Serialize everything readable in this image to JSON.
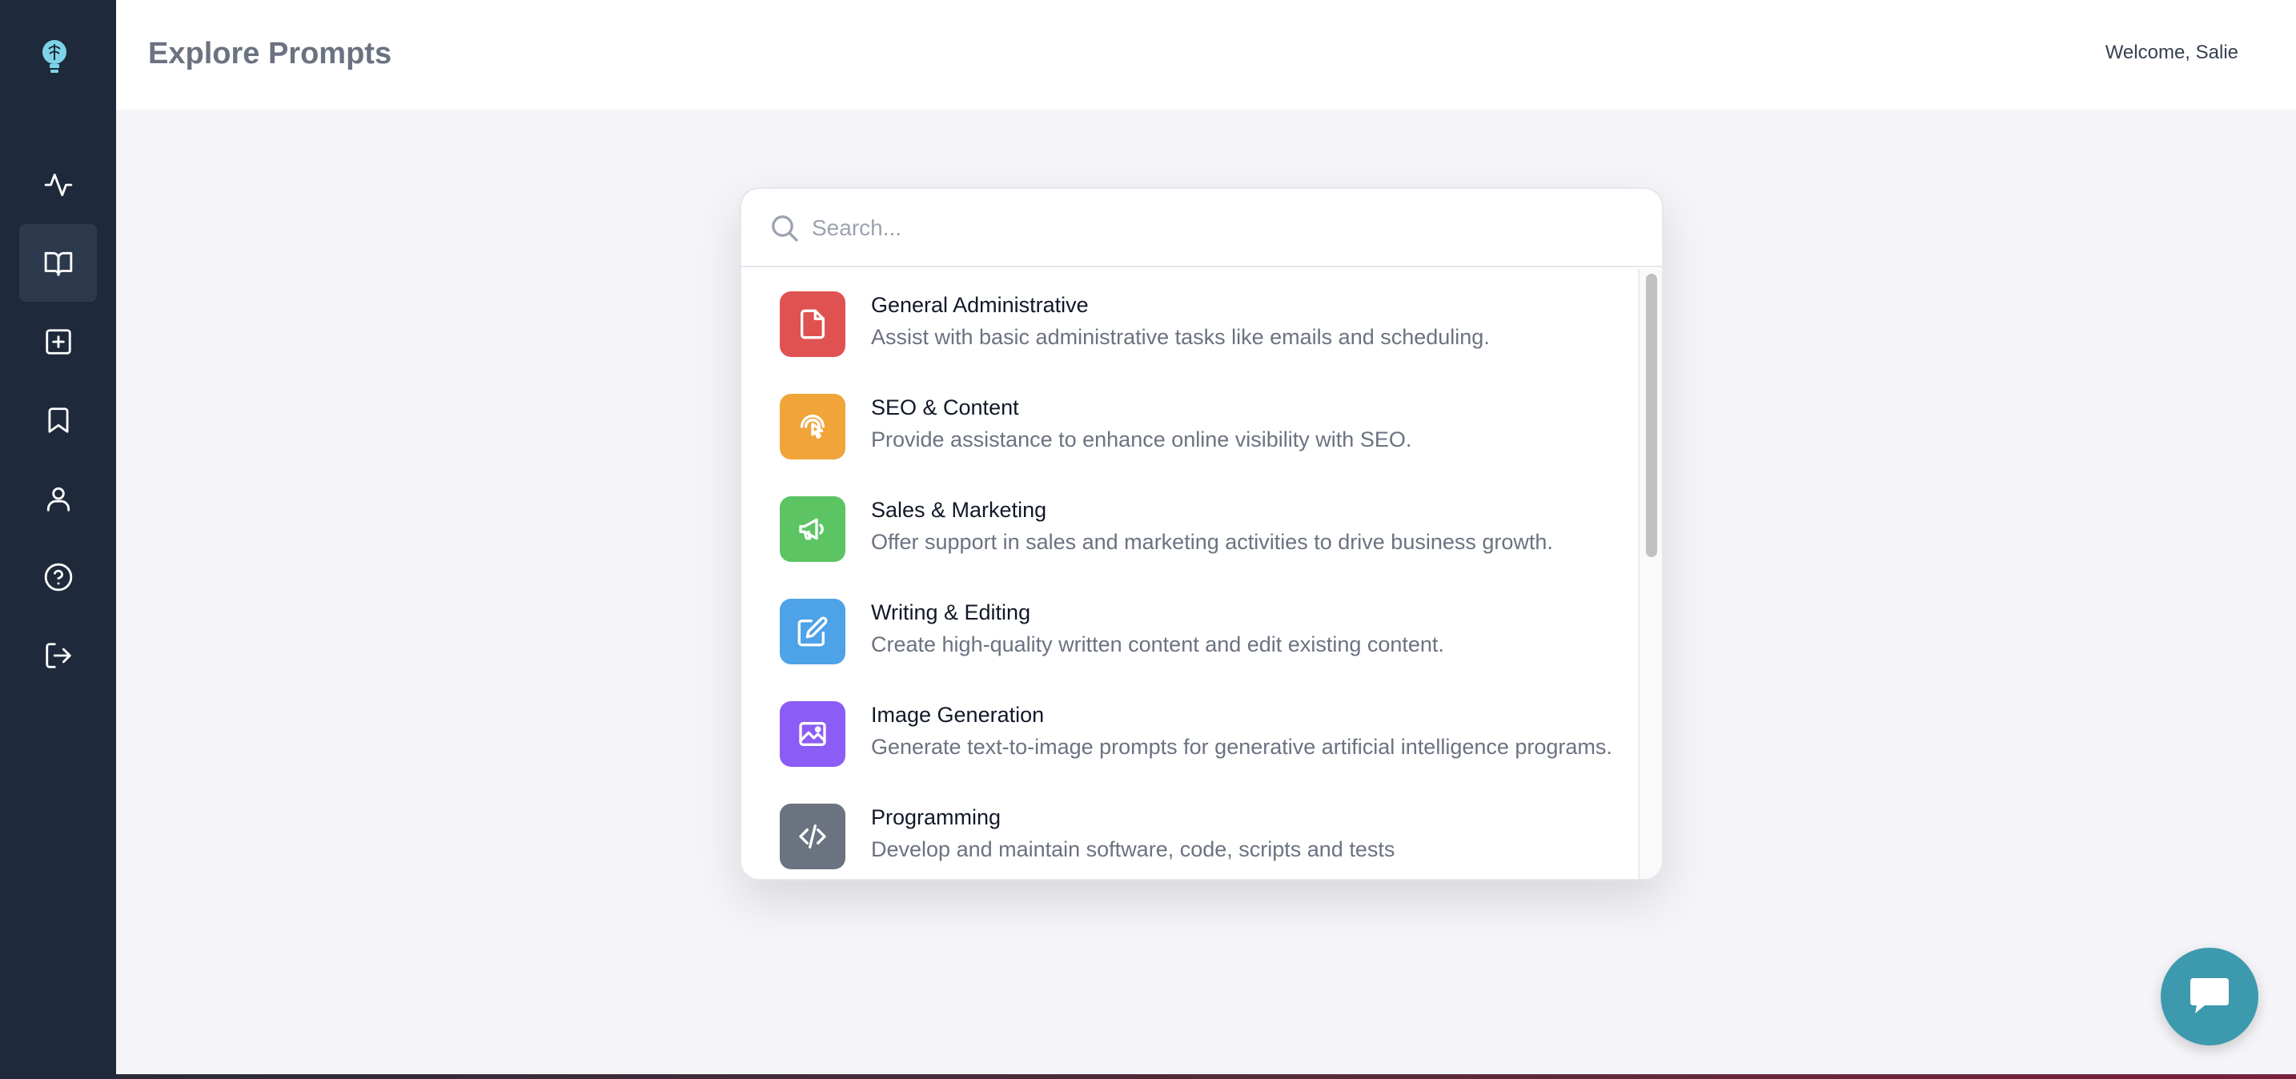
{
  "header": {
    "title": "Explore Prompts",
    "welcome": "Welcome, Salie"
  },
  "sidebar": {
    "logo_icon": "lightbulb-brain-icon",
    "items": [
      {
        "icon": "activity-icon",
        "active": false
      },
      {
        "icon": "book-open-icon",
        "active": true
      },
      {
        "icon": "plus-square-icon",
        "active": false
      },
      {
        "icon": "bookmark-icon",
        "active": false
      },
      {
        "icon": "user-icon",
        "active": false
      },
      {
        "icon": "help-circle-icon",
        "active": false
      },
      {
        "icon": "logout-icon",
        "active": false
      }
    ]
  },
  "search": {
    "placeholder": "Search...",
    "value": ""
  },
  "categories": [
    {
      "title": "General Administrative",
      "description": "Assist with basic administrative tasks like emails and scheduling.",
      "icon": "document-icon",
      "color": "#e05252"
    },
    {
      "title": "SEO & Content",
      "description": "Provide assistance to enhance online visibility with SEO.",
      "icon": "pointer-click-icon",
      "color": "#f0a43a"
    },
    {
      "title": "Sales & Marketing",
      "description": "Offer support in sales and marketing activities to drive business growth.",
      "icon": "megaphone-icon",
      "color": "#5cc463"
    },
    {
      "title": "Writing & Editing",
      "description": "Create high-quality written content and edit existing content.",
      "icon": "pencil-square-icon",
      "color": "#4ea3e8"
    },
    {
      "title": "Image Generation",
      "description": "Generate text-to-image prompts for generative artificial intelligence programs.",
      "icon": "image-icon",
      "color": "#8b5cf6"
    },
    {
      "title": "Programming",
      "description": "Develop and maintain software, code, scripts and tests",
      "icon": "code-icon",
      "color": "#6b7280"
    }
  ],
  "chat": {
    "icon": "chat-bubble-icon",
    "color": "#3d9aae"
  }
}
